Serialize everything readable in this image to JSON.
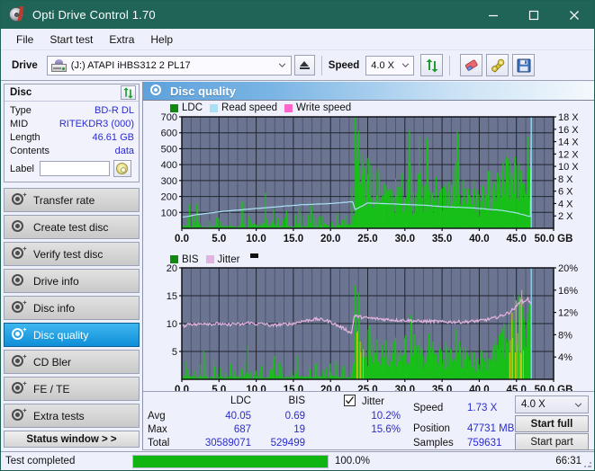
{
  "window": {
    "title": "Opti Drive Control 1.70",
    "icon": "disc-icon",
    "minimize": "minimize",
    "maximize": "maximize",
    "close": "close"
  },
  "menu": {
    "items": [
      {
        "label": "File"
      },
      {
        "label": "Start test"
      },
      {
        "label": "Extra"
      },
      {
        "label": "Help"
      }
    ]
  },
  "toolbar": {
    "drive_label": "Drive",
    "drive_value": "(J:)  ATAPI iHBS312  2 PL17",
    "eject_icon": "eject-icon",
    "speed_label": "Speed",
    "speed_value": "4.0 X",
    "refresh_icon": "refresh-icon",
    "erase_icon": "eraser-icon",
    "tools_icon": "wrench-icon",
    "save_icon": "save-icon"
  },
  "disc_panel": {
    "title": "Disc",
    "refresh_icon": "refresh-icon",
    "rows": [
      {
        "key": "Type",
        "value": "BD-R DL"
      },
      {
        "key": "MID",
        "value": "RITEKDR3 (000)"
      },
      {
        "key": "Length",
        "value": "46.61 GB"
      },
      {
        "key": "Contents",
        "value": "data"
      }
    ],
    "label_key": "Label",
    "label_value": "",
    "label_placeholder": "",
    "disc_button_icon": "cd-icon"
  },
  "sidebar": {
    "items": [
      {
        "label": "Transfer rate",
        "icon": "disc-icon",
        "active": false
      },
      {
        "label": "Create test disc",
        "icon": "disc-icon",
        "active": false
      },
      {
        "label": "Verify test disc",
        "icon": "disc-icon",
        "active": false
      },
      {
        "label": "Drive info",
        "icon": "disc-icon",
        "active": false
      },
      {
        "label": "Disc info",
        "icon": "disc-icon",
        "active": false
      },
      {
        "label": "Disc quality",
        "icon": "disc-icon",
        "active": true
      },
      {
        "label": "CD Bler",
        "icon": "disc-icon",
        "active": false
      },
      {
        "label": "FE / TE",
        "icon": "disc-icon",
        "active": false
      },
      {
        "label": "Extra tests",
        "icon": "disc-icon",
        "active": false
      }
    ],
    "status_window_button": "Status window > >"
  },
  "content": {
    "header_title": "Disc quality",
    "header_icon": "disc-icon"
  },
  "stats": {
    "col_ldc": "LDC",
    "col_bis": "BIS",
    "row_avg": "Avg",
    "row_max": "Max",
    "row_total": "Total",
    "avg_ldc": "40.05",
    "avg_bis": "0.69",
    "max_ldc": "687",
    "max_bis": "19",
    "total_ldc": "30589071",
    "total_bis": "529499",
    "jitter_label": "Jitter",
    "jitter_checked": true,
    "jitter_avg": "10.2%",
    "jitter_max": "15.6%",
    "speed_label": "Speed",
    "speed_value": "1.73 X",
    "position_label": "Position",
    "position_value": "47731 MB",
    "samples_label": "Samples",
    "samples_value": "759631",
    "speed_select": "4.0 X",
    "start_full": "Start full",
    "start_part": "Start part"
  },
  "statusbar": {
    "message": "Test completed",
    "progress_percent": "100.0%",
    "progress_value": 100,
    "elapsed": "66:31"
  },
  "colors": {
    "titlebar": "#1f6457",
    "accent": "#0f8fd8",
    "value_blue": "#2b2bd0",
    "ldc_green": "#17c117",
    "bis_green": "#17c117",
    "jitter_pink": "#e3b4e0",
    "read_speed": "#a8e0f5",
    "write_speed": "#ff66cc",
    "plot_bg": "#6b7490",
    "progress_green": "#11b511",
    "yellow_band": "#c8cc10"
  },
  "chart_data": [
    {
      "type": "bar",
      "id": "ldc-chart",
      "title": "Disc quality - LDC / Read speed",
      "xlabel": "GB",
      "ylabel": "LDC",
      "y2label": "X",
      "xlim": [
        0,
        50
      ],
      "ylim": [
        0,
        700
      ],
      "y2lim": [
        0,
        18
      ],
      "grid": true,
      "legend": [
        "LDC",
        "Read speed",
        "Write speed"
      ],
      "legend_position": "top-left",
      "xticks": [
        "0.0",
        "5.0",
        "10.0",
        "15.0",
        "20.0",
        "25.0",
        "30.0",
        "35.0",
        "40.0",
        "45.0",
        "50.0 GB"
      ],
      "yticks": [
        "100",
        "200",
        "300",
        "400",
        "500",
        "600",
        "700"
      ],
      "y2ticks": [
        "2 X",
        "4 X",
        "6 X",
        "8 X",
        "10 X",
        "12 X",
        "14 X",
        "16 X",
        "18 X"
      ],
      "series": [
        {
          "name": "LDC",
          "color": "#17c117",
          "x": [
            0.2,
            0.5,
            0.9,
            1.3,
            1.7,
            2.1,
            2.6,
            3.0,
            3.4,
            3.9,
            4.3,
            4.7,
            5.2,
            5.6,
            6.0,
            6.5,
            6.9,
            7.3,
            7.8,
            8.2,
            8.6,
            9.0,
            9.4,
            9.8,
            10.2,
            10.6,
            11.0,
            11.4,
            11.8,
            12.2,
            12.6,
            13.0,
            13.5,
            13.9,
            14.3,
            14.7,
            15.1,
            15.6,
            16.0,
            16.4,
            16.8,
            17.3,
            17.7,
            18.1,
            18.5,
            19.0,
            19.4,
            19.8,
            20.2,
            20.7,
            21.1,
            21.5,
            22.0,
            22.4,
            22.8,
            23.2,
            23.4,
            23.6,
            23.8,
            24.0,
            24.2,
            24.5,
            24.8,
            25.1,
            25.4,
            25.7,
            26.0,
            26.4,
            26.7,
            27.0,
            27.4,
            27.8,
            28.2,
            28.6,
            29.0,
            29.4,
            29.8,
            30.2,
            30.6,
            31.0,
            31.4,
            31.8,
            32.2,
            32.6,
            33.0,
            33.4,
            33.8,
            34.2,
            34.6,
            35.0,
            35.4,
            35.8,
            36.2,
            36.6,
            37.0,
            37.4,
            37.8,
            38.2,
            38.6,
            39.0,
            39.4,
            39.8,
            40.2,
            40.6,
            41.0,
            41.4,
            41.8,
            42.2,
            42.6,
            43.0,
            43.4,
            43.8,
            44.2,
            44.6,
            45.0,
            45.4,
            45.8,
            46.2,
            46.6,
            46.9
          ],
          "values": [
            95,
            60,
            140,
            55,
            70,
            190,
            45,
            60,
            75,
            40,
            55,
            65,
            45,
            60,
            50,
            70,
            55,
            45,
            60,
            220,
            50,
            65,
            75,
            120,
            60,
            50,
            270,
            90,
            55,
            160,
            70,
            45,
            80,
            55,
            120,
            60,
            45,
            180,
            55,
            70,
            50,
            140,
            60,
            45,
            90,
            55,
            200,
            60,
            75,
            50,
            165,
            110,
            60,
            140,
            95,
            560,
            690,
            530,
            470,
            350,
            420,
            300,
            280,
            590,
            330,
            270,
            350,
            310,
            240,
            290,
            260,
            220,
            240,
            260,
            230,
            250,
            300,
            240,
            560,
            230,
            290,
            520,
            260,
            240,
            520,
            230,
            260,
            280,
            200,
            220,
            260,
            250,
            230,
            270,
            520,
            300,
            260,
            240,
            280,
            250,
            230,
            210,
            200,
            230,
            260,
            300,
            260,
            240,
            300,
            380,
            280,
            430,
            320,
            470,
            300,
            420,
            380,
            290,
            480,
            320
          ]
        },
        {
          "name": "Read speed",
          "color": "#a8e0f5",
          "type": "line",
          "axis": "y2",
          "x": [
            0.2,
            2.0,
            4.0,
            6.0,
            8.0,
            10.0,
            12.0,
            14.0,
            16.0,
            18.0,
            20.0,
            22.0,
            23.0,
            23.3,
            25.0,
            27.0,
            29.0,
            31.0,
            33.0,
            35.0,
            37.0,
            39.0,
            41.0,
            43.0,
            45.0,
            46.5,
            46.9,
            46.95
          ],
          "values": [
            1.8,
            2.2,
            2.5,
            2.8,
            3.0,
            3.2,
            3.4,
            3.6,
            3.8,
            3.9,
            4.0,
            4.2,
            4.3,
            3.0,
            4.1,
            4.0,
            3.9,
            3.8,
            3.7,
            3.5,
            3.4,
            3.3,
            3.1,
            2.9,
            2.5,
            2.0,
            1.9,
            18.0
          ]
        },
        {
          "name": "Write speed",
          "color": "#ff66cc",
          "type": "line",
          "axis": "y2",
          "x": [],
          "values": []
        }
      ]
    },
    {
      "type": "bar",
      "id": "bis-chart",
      "title": "Disc quality - BIS / Jitter",
      "xlabel": "GB",
      "ylabel": "BIS",
      "y2label": "%",
      "xlim": [
        0,
        50
      ],
      "ylim": [
        0,
        20
      ],
      "y2lim": [
        0,
        20
      ],
      "grid": true,
      "legend": [
        "BIS",
        "Jitter"
      ],
      "legend_position": "top-left",
      "xticks": [
        "0.0",
        "5.0",
        "10.0",
        "15.0",
        "20.0",
        "25.0",
        "30.0",
        "35.0",
        "40.0",
        "45.0",
        "50.0 GB"
      ],
      "yticks": [
        "5",
        "10",
        "15",
        "20"
      ],
      "y2ticks": [
        "4%",
        "8%",
        "12%",
        "16%",
        "20%"
      ],
      "series": [
        {
          "name": "BIS",
          "color": "#17c117",
          "x": [
            0.3,
            0.8,
            1.3,
            1.8,
            2.3,
            2.8,
            3.3,
            3.8,
            4.3,
            4.8,
            5.3,
            5.8,
            6.3,
            6.8,
            7.3,
            7.8,
            8.3,
            8.8,
            9.3,
            9.8,
            10.3,
            10.8,
            11.3,
            11.8,
            12.3,
            12.8,
            13.3,
            13.8,
            14.3,
            14.8,
            15.3,
            15.8,
            16.3,
            16.8,
            17.3,
            17.8,
            18.3,
            18.8,
            19.3,
            19.8,
            20.3,
            20.8,
            21.3,
            21.8,
            22.3,
            22.8,
            23.2,
            23.4,
            23.7,
            24.0,
            24.4,
            24.8,
            25.2,
            25.6,
            26.0,
            26.5,
            27.0,
            27.5,
            28.0,
            28.5,
            29.0,
            29.5,
            30.0,
            30.5,
            31.0,
            31.5,
            32.0,
            32.5,
            33.0,
            33.5,
            34.0,
            34.5,
            35.0,
            35.5,
            36.0,
            36.5,
            37.0,
            37.5,
            38.0,
            38.5,
            39.0,
            39.5,
            40.0,
            40.5,
            41.0,
            41.5,
            42.0,
            42.5,
            43.0,
            43.5,
            44.0,
            44.5,
            45.0,
            45.5,
            46.0,
            46.5,
            46.9
          ],
          "values": [
            2.8,
            2.0,
            3.0,
            1.5,
            2.2,
            4.0,
            1.8,
            2.0,
            2.4,
            1.6,
            2.0,
            1.8,
            2.5,
            1.9,
            2.2,
            1.7,
            2.0,
            5.0,
            2.1,
            2.4,
            3.0,
            1.8,
            2.2,
            2.0,
            3.6,
            2.2,
            2.0,
            1.8,
            2.4,
            2.0,
            4.3,
            2.2,
            1.9,
            2.0,
            2.2,
            2.0,
            2.4,
            1.8,
            2.1,
            2.0,
            2.6,
            2.2,
            1.9,
            2.0,
            2.2,
            2.0,
            16.0,
            19.0,
            13.0,
            9.0,
            7.5,
            6.0,
            8.0,
            5.5,
            6.5,
            7.0,
            5.0,
            6.0,
            4.5,
            7.0,
            5.5,
            4.0,
            6.5,
            5.0,
            11.5,
            4.5,
            6.0,
            4.0,
            5.5,
            7.5,
            4.5,
            5.0,
            4.0,
            5.5,
            4.5,
            4.0,
            9.5,
            4.5,
            5.0,
            4.0,
            4.5,
            3.5,
            4.0,
            4.5,
            4.0,
            5.0,
            5.5,
            6.0,
            7.0,
            8.5,
            10.0,
            12.0,
            13.0,
            12.5,
            13.5,
            12.0,
            11.0
          ]
        },
        {
          "name": "Jitter",
          "color": "#e3b4e0",
          "type": "line",
          "axis": "y2",
          "x": [
            0.3,
            1.0,
            2.0,
            3.0,
            4.0,
            5.0,
            6.0,
            7.0,
            8.0,
            9.0,
            10.0,
            11.0,
            12.0,
            13.0,
            14.0,
            15.0,
            16.0,
            17.0,
            18.0,
            19.0,
            20.0,
            21.0,
            22.0,
            22.8,
            23.2,
            24.0,
            25.0,
            26.0,
            27.0,
            28.0,
            29.0,
            30.0,
            31.0,
            32.0,
            33.0,
            34.0,
            35.0,
            36.0,
            37.0,
            38.0,
            39.0,
            40.0,
            41.0,
            42.0,
            43.0,
            44.0,
            45.0,
            45.5,
            46.0,
            46.5,
            46.9
          ],
          "values": [
            9.6,
            10.0,
            9.8,
            10.1,
            9.9,
            10.0,
            9.7,
            10.0,
            9.8,
            10.2,
            9.9,
            10.0,
            9.6,
            9.8,
            9.9,
            10.0,
            10.4,
            10.6,
            10.8,
            10.7,
            10.3,
            9.6,
            9.0,
            8.2,
            11.4,
            11.2,
            11.0,
            10.9,
            10.8,
            10.7,
            10.6,
            10.6,
            10.5,
            10.4,
            10.4,
            10.4,
            10.3,
            10.3,
            10.3,
            10.3,
            10.4,
            10.5,
            10.7,
            11.0,
            11.4,
            12.0,
            13.0,
            14.2,
            13.8,
            14.6,
            13.4
          ]
        }
      ]
    }
  ]
}
